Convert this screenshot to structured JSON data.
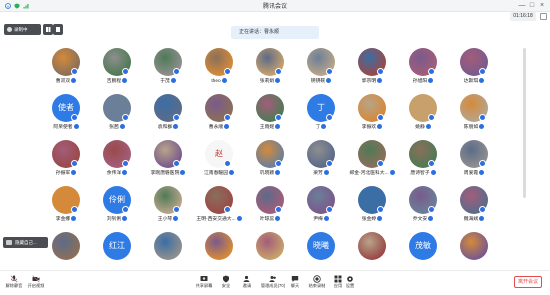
{
  "window": {
    "title": "腾讯会议",
    "minimize": "—",
    "maximize": "□",
    "close": "×"
  },
  "topbar": {
    "clock": "01:16:18"
  },
  "speaking": {
    "text": "正在讲话：曹永顺"
  },
  "recording": {
    "label": "录制中"
  },
  "mini_window": {
    "label": "隐藏自己..."
  },
  "participants": [
    [
      "曹双双",
      "吉鹏程",
      "于茂",
      "theo",
      "张莉娟",
      "钥钥碗",
      "郭宗明",
      "孙旭阳",
      "达斯琪"
    ],
    [
      "阿呆使者",
      "张茜",
      "袁和群",
      "曹永顺",
      "王雨妮",
      "丁",
      "李振欢",
      "姚静",
      "陈丽如"
    ],
    [
      "孙振军",
      "余伟洋",
      "李刚唐磐医院",
      "江南春暖园",
      "巩晓颖",
      "梁芳",
      "郑金-河北医科大...",
      "唐诗智子",
      "周爱霞"
    ],
    [
      "李金娜",
      "刘钊俐",
      "王小琴",
      "王明-西安交通大...",
      "叶琼蕊",
      "尹梅",
      "张金婷",
      "乔文安",
      "魏海斌"
    ],
    [
      "",
      "",
      "",
      "",
      "",
      "",
      "",
      "",
      ""
    ]
  ],
  "avatar_text": {
    "1-0": "使者",
    "1-5": "丁",
    "3-1": "伶俐",
    "4-1": "红江",
    "4-5": "晓曦",
    "4-7": "茂敏",
    "2-3": "赵"
  },
  "colors": {
    "accent": "#2d6fe0",
    "leave": "#e34d4d",
    "speaking_bg": "#e6f0fb"
  },
  "bottom_bar": {
    "left": [
      {
        "name": "mute",
        "label": "解除静音"
      },
      {
        "name": "video",
        "label": "开启视频"
      }
    ],
    "center": [
      {
        "name": "share",
        "label": "共享屏幕"
      },
      {
        "name": "security",
        "label": "安全"
      },
      {
        "name": "invite",
        "label": "邀请"
      },
      {
        "name": "members",
        "label": "管理成员(70)"
      },
      {
        "name": "chat",
        "label": "聊天"
      },
      {
        "name": "record",
        "label": "结束录制"
      },
      {
        "name": "apps",
        "label": "应用"
      },
      {
        "name": "settings",
        "label": "设置"
      }
    ],
    "leave": "离开会议"
  }
}
